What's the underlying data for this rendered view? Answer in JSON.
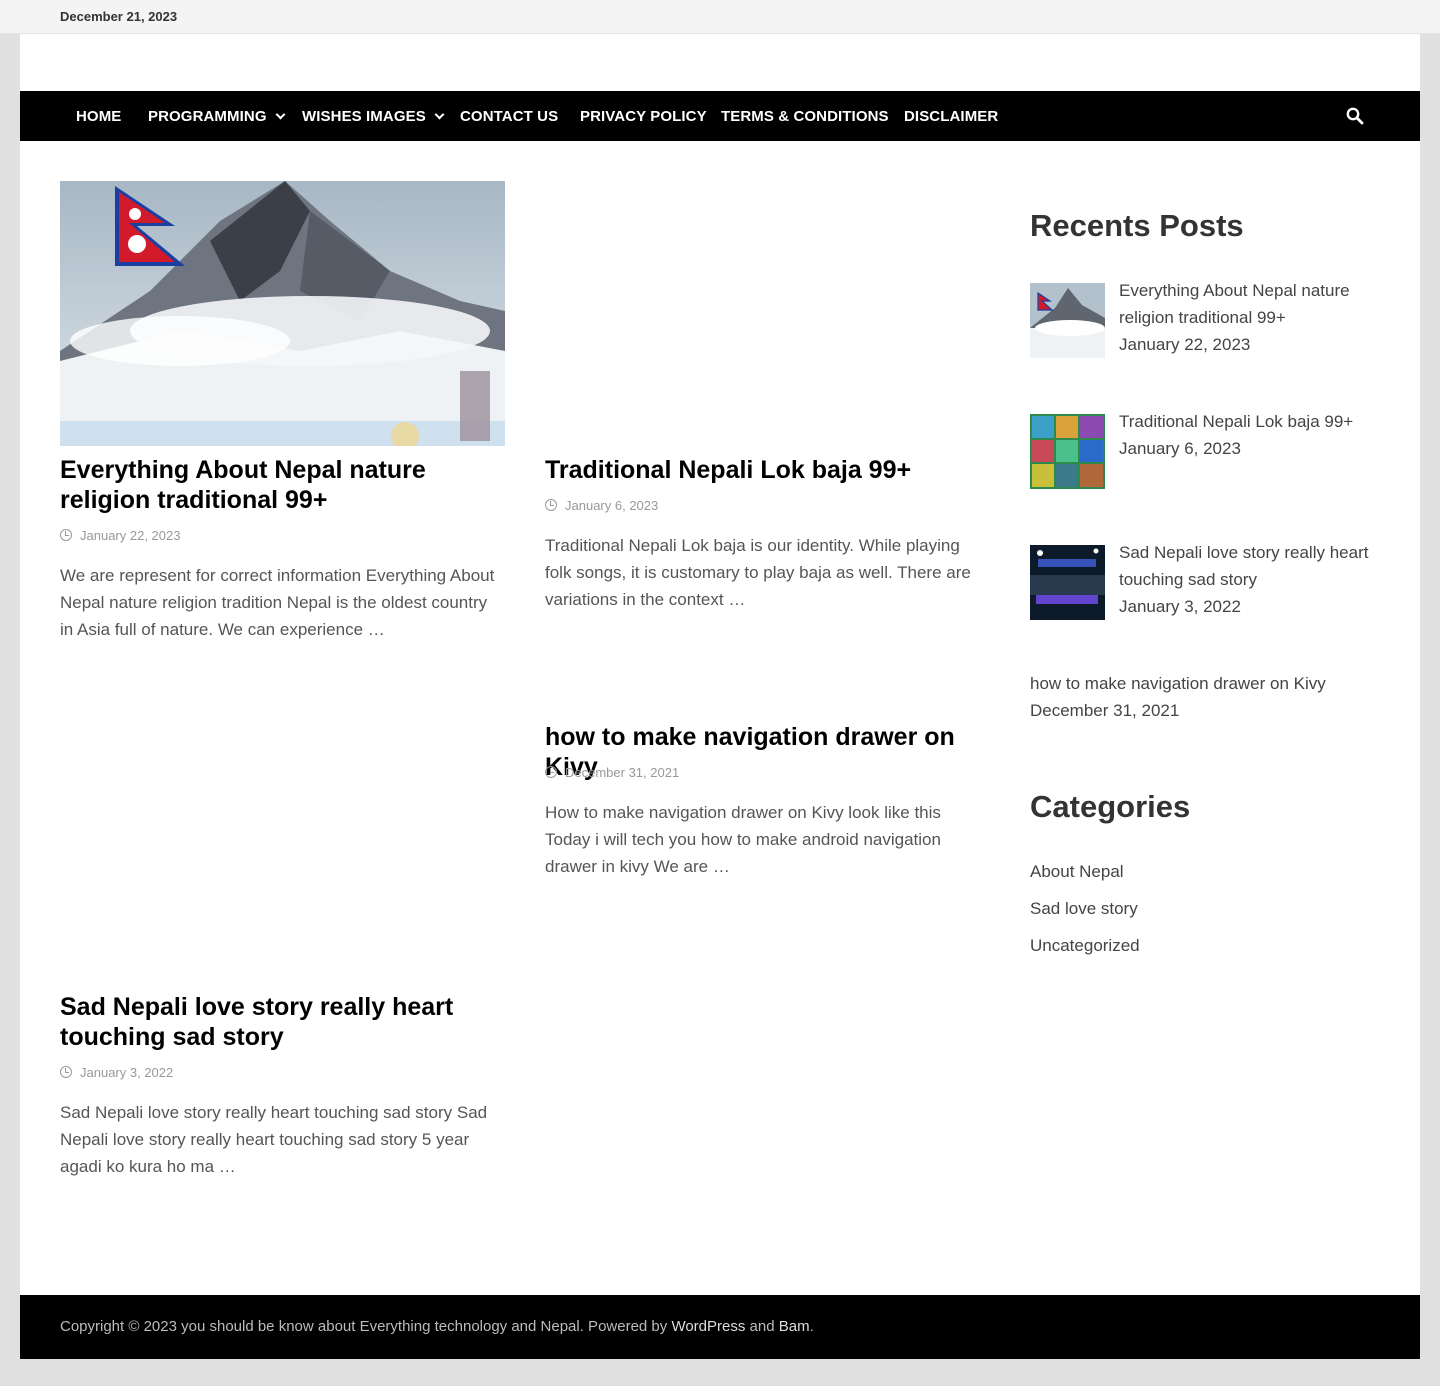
{
  "topbar": {
    "date": "December 21, 2023"
  },
  "nav": {
    "items": [
      {
        "label": "HOME"
      },
      {
        "label": "PROGRAMMING"
      },
      {
        "label": "WISHES IMAGES"
      },
      {
        "label": "CONTACT US"
      },
      {
        "label": "PRIVACY POLICY"
      },
      {
        "label": "TERMS & CONDITIONS"
      },
      {
        "label": "DISCLAIMER"
      }
    ],
    "search_icon": "search-icon"
  },
  "posts": [
    {
      "title": "Everything About Nepal nature religion traditional 99+",
      "date": "January 22, 2023",
      "excerpt": "We are represent for correct information Everything About Nepal nature religion tradition Nepal is the oldest country in Asia full of nature. We can experience …"
    },
    {
      "title": "Traditional Nepali Lok baja 99+",
      "date": "January 6, 2023",
      "excerpt": "Traditional Nepali Lok baja  is our identity.  While playing folk songs, it is customary to play baja as well.  There are variations in the  context …"
    },
    {
      "title": "how to make navigation drawer on Kivy",
      "date": "December 31, 2021",
      "excerpt": "How to make navigation drawer on Kivy look like this Today i will tech you how to  make android navigation drawer in kivy We are …"
    },
    {
      "title": "Sad Nepali love story really heart touching sad story",
      "date": "January 3, 2022",
      "excerpt": "Sad Nepali love story really heart touching sad story Sad Nepali love story really heart touching sad story 5 year agadi ko kura ho ma …"
    }
  ],
  "sidebar": {
    "recent_heading": "Recents Posts",
    "recent": [
      {
        "title": "Everything About Nepal nature religion traditional 99+",
        "date": "January 22, 2023"
      },
      {
        "title": "Traditional Nepali Lok baja 99+",
        "date": "January 6, 2023"
      },
      {
        "title": "Sad Nepali love story really heart touching sad story",
        "date": "January 3, 2022"
      },
      {
        "title": "how to make navigation drawer on Kivy",
        "date": "December 31, 2021"
      }
    ],
    "categories_heading": "Categories",
    "categories": [
      "About Nepal",
      "Sad love story",
      "Uncategorized"
    ]
  },
  "footer": {
    "prefix": "Copyright © 2023 you should be know about Everything technology and Nepal. Powered by ",
    "wordpress": "WordPress",
    "and": " and ",
    "bam": "Bam",
    "suffix": "."
  }
}
